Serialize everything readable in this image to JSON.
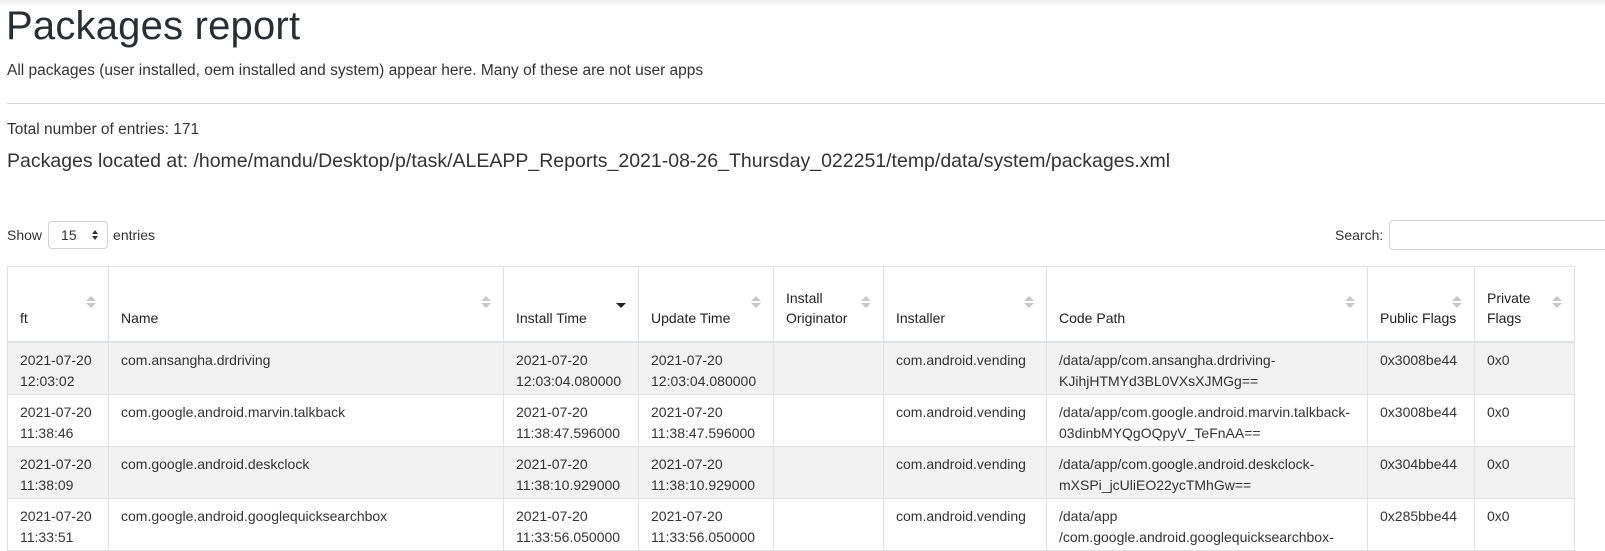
{
  "header": {
    "title": "Packages report",
    "subtitle": "All packages (user installed, oem installed and system) appear here. Many of these are not user apps",
    "total": "Total number of entries: 171",
    "located": "Packages located at: /home/mandu/Desktop/p/task/ALEAPP_Reports_2021-08-26_Thursday_022251/temp/data/system/packages.xml"
  },
  "controls": {
    "show_label": "Show",
    "entries_value": "15",
    "entries_label": "entries",
    "search_label": "Search:",
    "search_value": ""
  },
  "table": {
    "columns": [
      {
        "label": "ft"
      },
      {
        "label": "Name"
      },
      {
        "label": "Install Time",
        "sorted": "desc"
      },
      {
        "label": "Update Time"
      },
      {
        "label": "Install Originator"
      },
      {
        "label": "Installer"
      },
      {
        "label": "Code Path"
      },
      {
        "label": "Public Flags"
      },
      {
        "label": "Private Flags"
      }
    ],
    "rows": [
      [
        "2021-07-20 12:03:02",
        "com.ansangha.drdriving",
        "2021-07-20 12:03:04.080000",
        "2021-07-20 12:03:04.080000",
        "",
        "com.android.vending",
        "/data/app/com.ansangha.drdriving-KJihjHTMYd3BL0VXsXJMGg==",
        "0x3008be44",
        "0x0"
      ],
      [
        "2021-07-20 11:38:46",
        "com.google.android.marvin.talkback",
        "2021-07-20 11:38:47.596000",
        "2021-07-20 11:38:47.596000",
        "",
        "com.android.vending",
        "/data/app/com.google.android.marvin.talkback-03dinbMYQgOQpyV_TeFnAA==",
        "0x3008be44",
        "0x0"
      ],
      [
        "2021-07-20 11:38:09",
        "com.google.android.deskclock",
        "2021-07-20 11:38:10.929000",
        "2021-07-20 11:38:10.929000",
        "",
        "com.android.vending",
        "/data/app/com.google.android.deskclock-mXSPi_jcUliEO22ycTMhGw==",
        "0x304bbe44",
        "0x0"
      ],
      [
        "2021-07-20 11:33:51",
        "com.google.android.googlequicksearchbox",
        "2021-07-20 11:33:56.050000",
        "2021-07-20 11:33:56.050000",
        "",
        "com.android.vending",
        "/data/app /com.google.android.googlequicksearchbox-",
        "0x285bbe44",
        "0x0"
      ]
    ]
  }
}
